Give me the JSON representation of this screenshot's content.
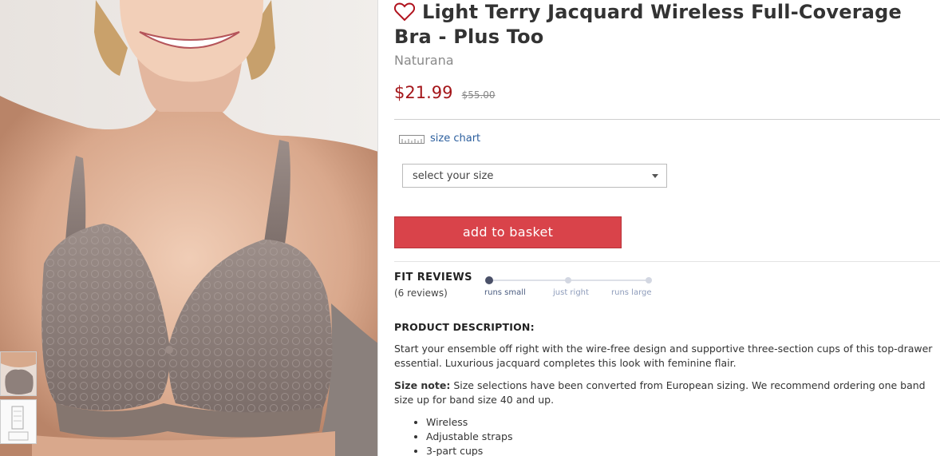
{
  "product": {
    "title": "Light Terry Jacquard Wireless Full-Coverage Bra - Plus Too",
    "brand": "Naturana",
    "sale_price": "$21.99",
    "original_price": "$55.00"
  },
  "size_chart": {
    "label": "size chart"
  },
  "size_select": {
    "selected": "select your size"
  },
  "basket_button": {
    "label": "add to basket"
  },
  "fit_reviews": {
    "heading": "FIT REVIEWS",
    "count": "(6 reviews)",
    "scale": [
      "runs small",
      "just right",
      "runs large"
    ],
    "selected": "runs small"
  },
  "description": {
    "heading": "PRODUCT DESCRIPTION:",
    "body": "Start your ensemble off right with the wire-free design and supportive three-section cups of this top-drawer essential. Luxurious jacquard completes this look with feminine flair.",
    "size_note_label": "Size note:",
    "size_note": "Size selections have been converted from European sizing. We recommend ordering one band size up for band size 40 and up.",
    "features": [
      "Wireless",
      "Adjustable straps",
      "3-part cups"
    ]
  },
  "colors": {
    "price": "#a4161a",
    "button": "#d9434a",
    "link": "#2c5f9e"
  },
  "icons": {
    "favorite": "heart-outline-icon",
    "size_chart": "ruler-icon",
    "dropdown": "caret-down-icon"
  }
}
